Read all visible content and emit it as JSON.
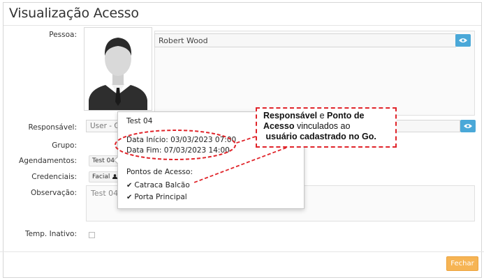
{
  "modal": {
    "title": "Visualização Acesso"
  },
  "form": {
    "pessoa_label": "Pessoa:",
    "pessoa_value": "Robert Wood",
    "responsavel_label": "Responsável:",
    "responsavel_value": "User - G",
    "grupo_label": "Grupo:",
    "agendamentos_label": "Agendamentos:",
    "agendamento_chip": "Test 04",
    "credenciais_label": "Credenciais:",
    "credencial_chip": "Facial",
    "observacao_label": "Observação:",
    "observacao_value": "Test 04",
    "temp_inativo_label": "Temp. Inativo:"
  },
  "popover": {
    "title": "Test 04",
    "data_inicio": "Data Início: 03/03/2023 07:00",
    "data_fim": "Data Fim: 07/03/2023 14:00",
    "pontos_label": "Pontos de Acesso:",
    "pontos": [
      "Catraca Balcão",
      "Porta Principal"
    ]
  },
  "annotation": {
    "part1": "Responsável",
    "part2": " e ",
    "part3": "Ponto de Acesso",
    "part4": " vinculados ao ",
    "part5": "usuário cadastrado no Go."
  },
  "footer": {
    "close_label": "Fechar"
  },
  "colors": {
    "accent_blue": "#4aa8d8",
    "close_orange": "#f6b454",
    "annotation_red": "#e0242a"
  }
}
